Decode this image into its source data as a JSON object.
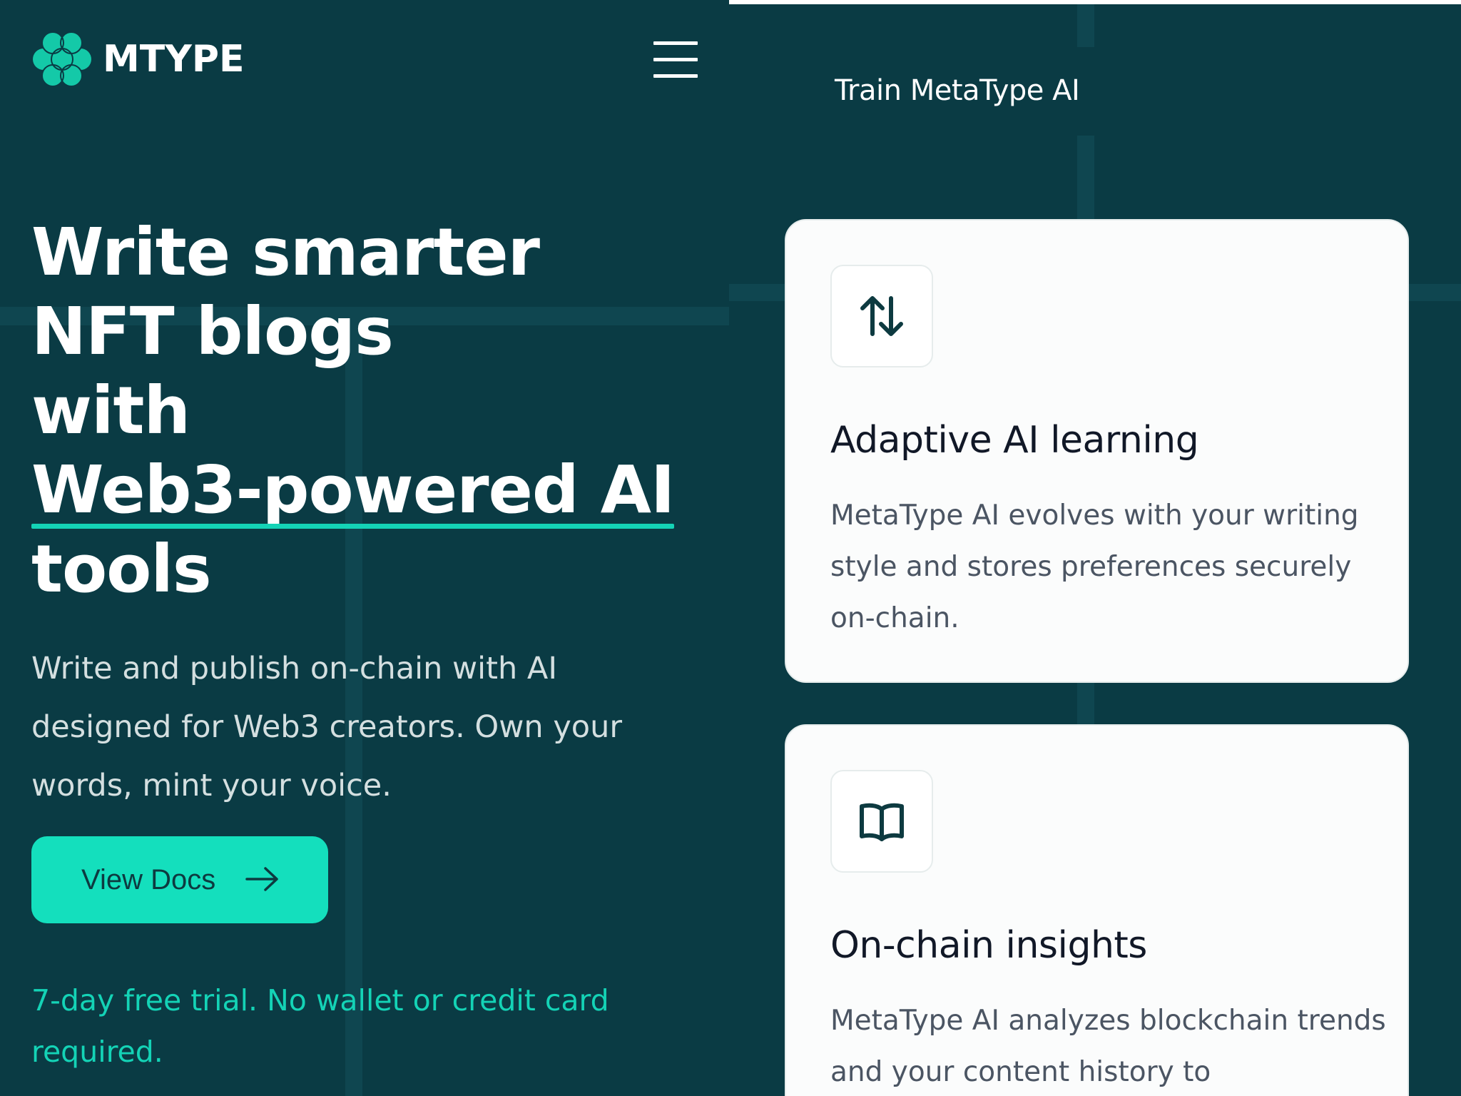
{
  "brand": {
    "name": "MTYPE",
    "logo_icon": "cluster-logo-icon",
    "accent_color": "#14dfbd",
    "background_color": "#0a3b44"
  },
  "header": {
    "menu_icon": "hamburger-menu-icon"
  },
  "hero": {
    "title_lines": [
      "Write smarter",
      "NFT blogs",
      "with",
      "Web3-powered AI",
      "tools"
    ],
    "subtitle": "Write and publish on-chain with AI designed for Web3 creators. Own your words, mint your voice.",
    "cta_label": "View Docs",
    "cta_icon": "arrow-right-icon",
    "trial_note": "7-day free trial. No wallet or credit card required."
  },
  "features": {
    "section_title": "Train MetaType AI",
    "cards": [
      {
        "icon": "arrows-up-down-icon",
        "title": "Adaptive AI learning",
        "description": "MetaType AI evolves with your writing style and stores preferences securely on-chain."
      },
      {
        "icon": "open-book-icon",
        "title": "On-chain insights",
        "description": "MetaType AI analyzes blockchain trends and your content history to"
      }
    ]
  }
}
